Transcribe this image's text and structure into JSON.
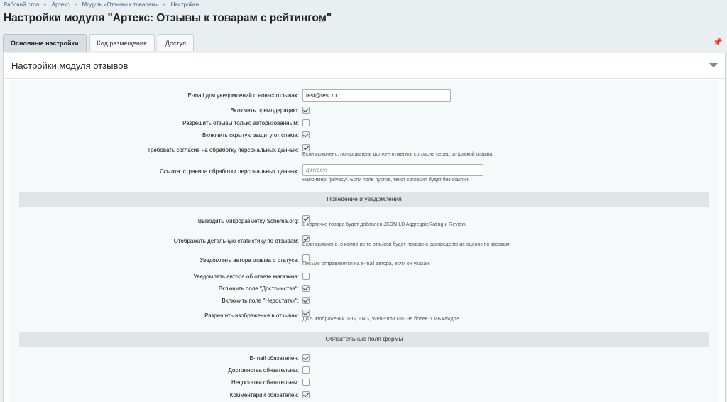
{
  "breadcrumb": [
    "Рабочий стол",
    "Артекс",
    "Модуль «Отзывы к товарам»",
    "Настройки"
  ],
  "title": "Настройки модуля \"Артекс: Отзывы к товарам с рейтингом\"",
  "tabs": [
    "Основные настройки",
    "Код размещения",
    "Доступ"
  ],
  "panel_title": "Настройки модуля отзывов",
  "fields": {
    "email_label": "E-mail для уведомлений о новых отзывах:",
    "email_value": "test@test.ru",
    "premod_label": "Включить премодерацию:",
    "authonly_label": "Разрешить отзывы только авторизованным:",
    "spam_label": "Включить скрытую защиту от спама:",
    "consent_label": "Требовать согласие на обработку персональных данных:",
    "consent_hint": "Если включено, пользователь должен отметить согласие перед отправкой отзыва.",
    "privacy_label": "Ссылка: страница обработки персональных данных:",
    "privacy_placeholder": "/privacy/",
    "privacy_hint": "Например: /privacy/. Если поле пустое, текст согласия будет без ссылки."
  },
  "section_behavior": "Поведение и уведомления",
  "behavior": {
    "schema_label": "Выводить микроразметку Schema.org:",
    "schema_hint": "В карточке товара будет добавлен JSON-LD AggregateRating и Review.",
    "stats_label": "Отображать детальную статистику по отзывам:",
    "stats_hint": "Если включено, в компоненте отзывов будет показано распределение оценок по звездам.",
    "notify_status_label": "Уведомлять автора отзыва о статусе:",
    "notify_status_hint": "Письмо отправляется на e-mail автора, если он указан.",
    "notify_reply_label": "Уведомлять автора об ответе магазина:",
    "pros_label": "Включить поле \"Достоинства\":",
    "cons_label": "Включить поле \"Недостатки\":",
    "images_label": "Разрешить изображения в отзывах:",
    "images_hint": "До 5 изображений JPG, PNG, WebP или GIF, не более 5 МБ каждое."
  },
  "section_required": "Обязательные поля формы",
  "required": {
    "email_label": "E-mail обязателен:",
    "pros_label": "Достоинства обязательны:",
    "cons_label": "Недостатки обязательны:",
    "comment_label": "Комментарий обязателен:"
  },
  "checks": {
    "premod": true,
    "authonly": false,
    "spam": true,
    "consent": true,
    "schema": true,
    "stats": true,
    "notify_status": false,
    "notify_reply": false,
    "pros": true,
    "cons": true,
    "images": true,
    "req_email": true,
    "req_pros": false,
    "req_cons": false,
    "req_comment": true
  }
}
